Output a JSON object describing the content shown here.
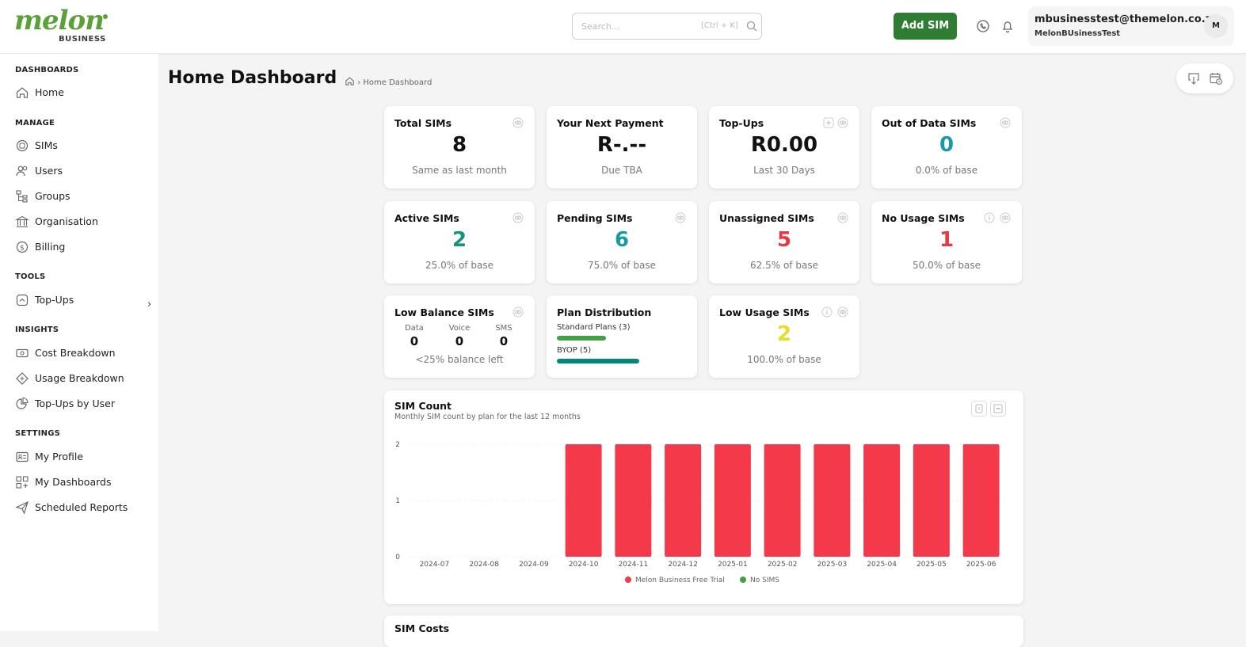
{
  "brand": {
    "name": "melon",
    "sub": "BUSINESS",
    "color": "#5aa137"
  },
  "search": {
    "placeholder": "Search...",
    "shortcut": "[Ctrl + K]"
  },
  "header": {
    "add_sim_label": "Add SIM",
    "user_email": "mbusinesstest@themelon.co.za",
    "user_org": "MelonBUsinessTest",
    "avatar_initial": "M"
  },
  "sidebar": {
    "sections": [
      {
        "label": "DASHBOARDS",
        "items": [
          {
            "label": "Home",
            "icon": "home-icon"
          }
        ]
      },
      {
        "label": "MANAGE",
        "items": [
          {
            "label": "SIMs",
            "icon": "sim-icon"
          },
          {
            "label": "Users",
            "icon": "users-icon"
          },
          {
            "label": "Groups",
            "icon": "groups-icon"
          },
          {
            "label": "Organisation",
            "icon": "bank-icon"
          },
          {
            "label": "Billing",
            "icon": "dollar-icon"
          }
        ]
      },
      {
        "label": "TOOLS",
        "items": [
          {
            "label": "Top-Ups",
            "icon": "topup-icon"
          }
        ]
      },
      {
        "label": "INSIGHTS",
        "items": [
          {
            "label": "Cost Breakdown",
            "icon": "cost-icon"
          },
          {
            "label": "Usage Breakdown",
            "icon": "usage-icon"
          },
          {
            "label": "Top-Ups by User",
            "icon": "pie-icon"
          }
        ]
      },
      {
        "label": "SETTINGS",
        "items": [
          {
            "label": "My Profile",
            "icon": "profile-icon"
          },
          {
            "label": "My Dashboards",
            "icon": "dashboards-icon"
          },
          {
            "label": "Scheduled Reports",
            "icon": "send-icon"
          }
        ]
      }
    ]
  },
  "page": {
    "title": "Home Dashboard",
    "breadcrumb": "Home Dashboard"
  },
  "cards": {
    "total_sims": {
      "title": "Total SIMs",
      "value": "8",
      "sub": "Same as last month"
    },
    "next_payment": {
      "title": "Your Next Payment",
      "value": "R-.--",
      "sub": "Due TBA"
    },
    "topups": {
      "title": "Top-Ups",
      "value": "R0.00",
      "sub": "Last 30 Days"
    },
    "out_of_data": {
      "title": "Out of Data SIMs",
      "value": "0",
      "sub": "0.0% of base"
    },
    "active": {
      "title": "Active SIMs",
      "value": "2",
      "sub": "25.0% of base"
    },
    "pending": {
      "title": "Pending SIMs",
      "value": "6",
      "sub": "75.0% of base"
    },
    "unassigned": {
      "title": "Unassigned SIMs",
      "value": "5",
      "sub": "62.5% of base"
    },
    "no_usage": {
      "title": "No Usage SIMs",
      "value": "1",
      "sub": "50.0% of base"
    },
    "low_balance": {
      "title": "Low Balance SIMs",
      "data_label": "Data",
      "data_value": "0",
      "voice_label": "Voice",
      "voice_value": "0",
      "sms_label": "SMS",
      "sms_value": "0",
      "sub": "<25% balance left"
    },
    "plan_distribution": {
      "title": "Plan Distribution",
      "plans": [
        {
          "label": "Standard Plans (3)",
          "count": 3,
          "color": "#43a047"
        },
        {
          "label": "BYOP (5)",
          "count": 5,
          "color": "#00897b"
        }
      ]
    },
    "low_usage": {
      "title": "Low Usage SIMs",
      "value": "2",
      "sub": "100.0% of base"
    }
  },
  "colors": {
    "teal": "#1a9aa8",
    "green": "#16927f",
    "red": "#e53945",
    "yellow": "#e6dc2a",
    "bar": "#f43a4a",
    "legend_green": "#43a047"
  },
  "sim_count": {
    "title": "SIM Count",
    "subtitle": "Monthly SIM count by plan for the last 12 months"
  },
  "sim_costs": {
    "title": "SIM Costs"
  },
  "chart_data": {
    "type": "bar",
    "categories": [
      "2024-07",
      "2024-08",
      "2024-09",
      "2024-10",
      "2024-11",
      "2024-12",
      "2025-01",
      "2025-02",
      "2025-03",
      "2025-04",
      "2025-05",
      "2025-06"
    ],
    "series": [
      {
        "name": "Melon Business Free Trial",
        "values": [
          0,
          0,
          0,
          2,
          2,
          2,
          2,
          2,
          2,
          2,
          2,
          2
        ],
        "color": "#f43a4a"
      },
      {
        "name": "No SIMS",
        "values": [
          0,
          0,
          0,
          0,
          0,
          0,
          0,
          0,
          0,
          0,
          0,
          0
        ],
        "color": "#43a047"
      }
    ],
    "yticks": [
      0,
      1,
      2
    ],
    "ylim": [
      0,
      2
    ]
  }
}
